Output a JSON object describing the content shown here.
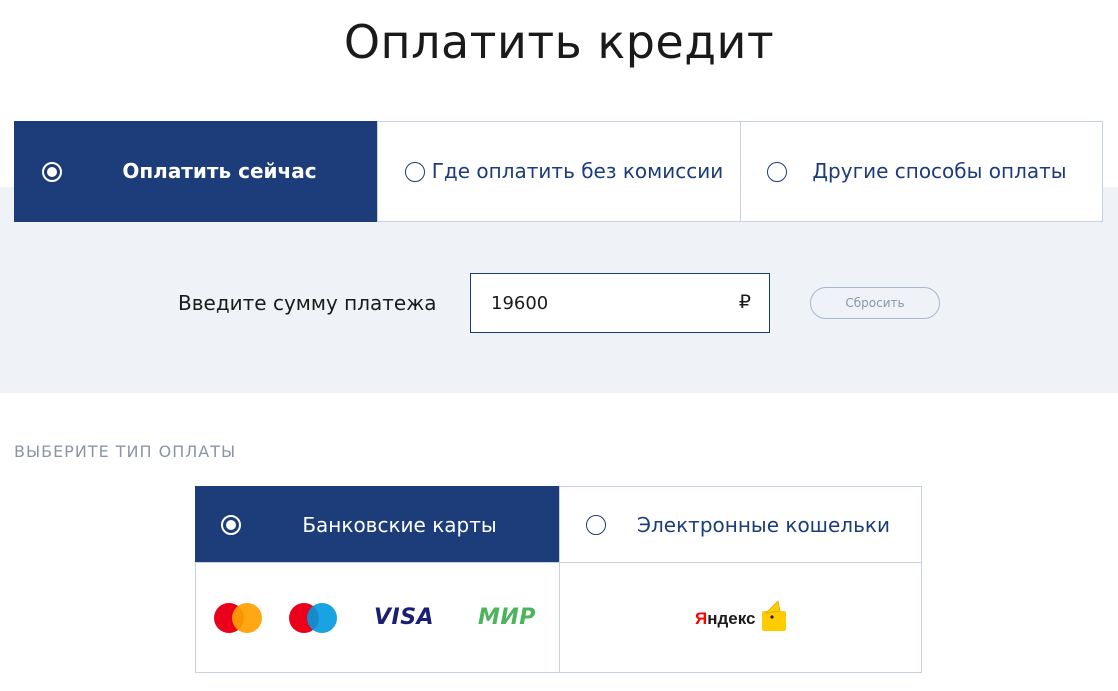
{
  "page": {
    "title": "Оплатить кредит"
  },
  "payment_tabs": [
    {
      "label": "Оплатить сейчас",
      "selected": true
    },
    {
      "label": "Где оплатить без комиссии",
      "selected": false
    },
    {
      "label": "Другие способы оплаты",
      "selected": false
    }
  ],
  "amount": {
    "label": "Введите сумму платежа",
    "value": "19600",
    "currency": "₽",
    "reset_label": "Сбросить"
  },
  "payment_type": {
    "heading": "ВЫБЕРИТЕ ТИП ОПЛАТЫ",
    "options": [
      {
        "label": "Банковские карты",
        "selected": true
      },
      {
        "label": "Электронные кошельки",
        "selected": false
      }
    ],
    "card_logos": {
      "icons": [
        "mastercard-icon",
        "maestro-icon",
        "visa-logo",
        "mir-logo"
      ],
      "visa_text": "VISA",
      "mir_text": "МИР"
    },
    "wallet_logos": {
      "icons": [
        "yandex-money-logo"
      ],
      "yandex_first": "Я",
      "yandex_rest": "ндекс"
    }
  },
  "colors": {
    "primary": "#1c3d7a",
    "band_background": "#eff2f6",
    "border": "#c8d1e0",
    "muted_text": "#8a96a8",
    "visa_blue": "#1a1f71",
    "mir_green": "#4db45e",
    "mastercard_red": "#eb001b",
    "mastercard_orange": "#ff9f00",
    "maestro_blue": "#0099df",
    "yandex_red": "#ff0000",
    "yandex_yellow": "#ffcc00"
  }
}
